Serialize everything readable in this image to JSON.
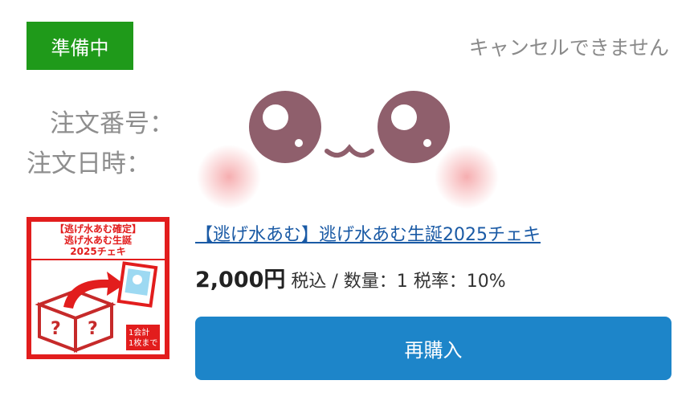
{
  "status": {
    "label": "準備中",
    "color": "#1f9a1a"
  },
  "cancel_note": "キャンセルできません",
  "order": {
    "number_label": "注文番号：",
    "date_label": "注文日時："
  },
  "thumbnail": {
    "banner_lines": [
      "【逃げ水あむ確定】",
      "逃げ水あむ生誕",
      "2025チェキ"
    ],
    "badge_lines": [
      "1会計",
      "1枚まで"
    ],
    "icons": [
      "box-icon",
      "arrow-icon",
      "photo-card-icon"
    ]
  },
  "product": {
    "title": "【逃げ水あむ】逃げ水あむ生誕2025チェキ",
    "price": "2,000円",
    "details": "税込 / 数量：1 税率：10%"
  },
  "actions": {
    "rebuy_label": "再購入",
    "rebuy_color": "#1d85c9"
  }
}
